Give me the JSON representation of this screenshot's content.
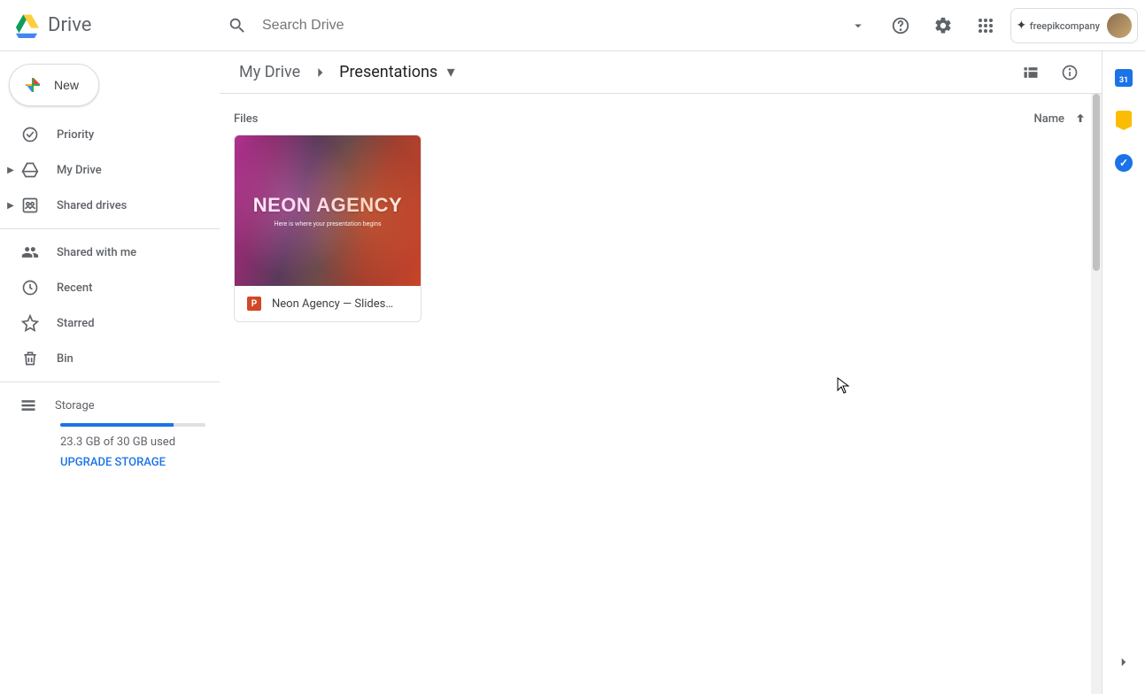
{
  "header": {
    "app_name": "Drive",
    "search_placeholder": "Search Drive",
    "brand": "freepikcompany"
  },
  "sidebar": {
    "new_label": "New",
    "items": [
      {
        "label": "Priority",
        "expandable": false
      },
      {
        "label": "My Drive",
        "expandable": true
      },
      {
        "label": "Shared drives",
        "expandable": true
      }
    ],
    "items2": [
      {
        "label": "Shared with me"
      },
      {
        "label": "Recent"
      },
      {
        "label": "Starred"
      },
      {
        "label": "Bin"
      }
    ],
    "storage": {
      "label": "Storage",
      "usage_text": "23.3 GB of 30 GB used",
      "percent": 78,
      "upgrade": "UPGRADE STORAGE"
    }
  },
  "breadcrumb": {
    "root": "My Drive",
    "current": "Presentations"
  },
  "content": {
    "section_label": "Files",
    "sort_label": "Name",
    "files": [
      {
        "name": "Neon Agency — Slides…",
        "thumb_title": "NEON AGENCY",
        "thumb_sub": "Here is where your presentation begins",
        "type": "P"
      }
    ]
  },
  "sidepanel": {
    "calendar_day": "31"
  }
}
